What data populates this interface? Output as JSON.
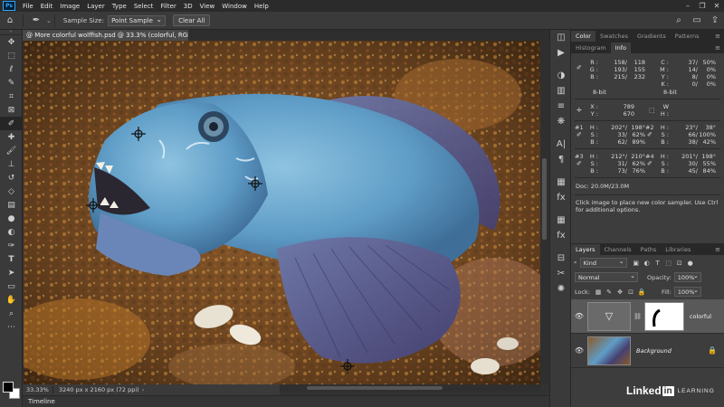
{
  "menu": {
    "logo": "Ps",
    "items": [
      "File",
      "Edit",
      "Image",
      "Layer",
      "Type",
      "Select",
      "Filter",
      "3D",
      "View",
      "Window",
      "Help"
    ]
  },
  "options_bar": {
    "sample_size_label": "Sample Size:",
    "sample_size_value": "Point Sample",
    "clear_all_label": "Clear All"
  },
  "document": {
    "tab_title": "@ More colorful wolffish.psd @ 33.3% (colorful, RGB/8) *",
    "close_glyph": "×"
  },
  "status": {
    "zoom": "33.33%",
    "doc_info": "3240 px x 2160 px (72 ppi)",
    "arrow": "›"
  },
  "timeline_label": "Timeline",
  "panel_tabs_top": [
    "Color",
    "Swatches",
    "Gradients",
    "Patterns"
  ],
  "panel_tabs_info": [
    "Histogram",
    "Info"
  ],
  "info": {
    "rgb": {
      "labels": [
        "R :",
        "G :",
        "B :"
      ],
      "v1": [
        "158/",
        "193/",
        "215/"
      ],
      "v2": [
        "118",
        "155",
        "232"
      ]
    },
    "cmyk": {
      "labels": [
        "C :",
        "M :",
        "Y :",
        "K :"
      ],
      "v1": [
        "37/",
        "14/",
        "8/",
        "0/"
      ],
      "v2": [
        "50%",
        "0%",
        "0%",
        "0%"
      ]
    },
    "bit_left": "8-bit",
    "bit_right": "8-bit",
    "xy": {
      "labels": [
        "X :",
        "Y :"
      ],
      "values": [
        "789",
        "670"
      ]
    },
    "wh": {
      "labels": [
        "W :",
        "H :"
      ]
    },
    "s1": {
      "tag": "#1",
      "labels": [
        "H :",
        "S :",
        "B :"
      ],
      "v1": [
        "202°/",
        "33/",
        "62/"
      ],
      "v2": [
        "198°",
        "62%",
        "89%"
      ]
    },
    "s2": {
      "tag": "#2",
      "labels": [
        "H :",
        "S :",
        "B :"
      ],
      "v1": [
        "23°/",
        "66/",
        "38/"
      ],
      "v2": [
        "38°",
        "100%",
        "42%"
      ]
    },
    "s3": {
      "tag": "#3",
      "labels": [
        "H :",
        "S :",
        "B :"
      ],
      "v1": [
        "212°/",
        "31/",
        "73/"
      ],
      "v2": [
        "210°",
        "62%",
        "76%"
      ]
    },
    "s4": {
      "tag": "#4",
      "labels": [
        "H :",
        "S :",
        "B :"
      ],
      "v1": [
        "201°/",
        "30/",
        "45/"
      ],
      "v2": [
        "198°",
        "55%",
        "84%"
      ]
    },
    "doc_size": "Doc: 20.0M/23.0M",
    "hint": "Click image to place new color sampler.  Use Ctrl for additional options."
  },
  "layers_tabs": [
    "Layers",
    "Channels",
    "Paths",
    "Libraries"
  ],
  "layers": {
    "kind_label": "Kind",
    "blend_mode": "Normal",
    "opacity_label": "Opacity:",
    "opacity_value": "100%",
    "lock_label": "Lock:",
    "fill_label": "Fill:",
    "fill_value": "100%",
    "items": [
      {
        "name": "colorful",
        "selected": true
      },
      {
        "name": "Background",
        "selected": false
      }
    ]
  },
  "watermark": {
    "linked": "Linked",
    "in": "in",
    "learning": "LEARNING"
  },
  "colors": {
    "accent": "#31a8ff",
    "panel": "#3d3d3d",
    "app_bg": "#323232"
  },
  "icons": {
    "tools": [
      "move-icon",
      "marquee-icon",
      "lasso-icon",
      "quick-select-icon",
      "crop-icon",
      "frame-icon",
      "eyedropper-icon",
      "healing-icon",
      "brush-icon",
      "clone-stamp-icon",
      "history-brush-icon",
      "eraser-icon",
      "gradient-icon",
      "blur-icon",
      "dodge-icon",
      "pen-icon",
      "type-icon",
      "path-select-icon",
      "rectangle-icon",
      "hand-icon",
      "zoom-icon",
      "more-tools-icon"
    ]
  }
}
